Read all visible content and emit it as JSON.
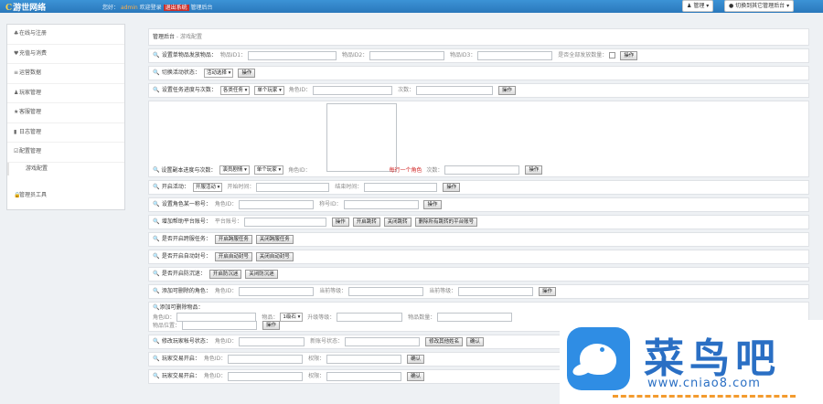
{
  "header": {
    "logo_mark": "C",
    "logo_text": "游世网络",
    "welcome_prefix": "您好：",
    "username": "admin",
    "welcome_mid": "欢迎登录",
    "exit_label": "退出系统",
    "welcome_suffix": "管理后台",
    "manage_button": "管理",
    "switch_button": "切换到其它管理后台"
  },
  "sidebar": {
    "items": [
      {
        "label": "在线与注册",
        "icon": "♣"
      },
      {
        "label": "充值与消费",
        "icon": "♥"
      },
      {
        "label": "运营数据",
        "icon": "≡"
      },
      {
        "label": "玩家管理",
        "icon": "♟"
      },
      {
        "label": "客服管理",
        "icon": "★"
      },
      {
        "label": "日志管理",
        "icon": "▮"
      },
      {
        "label": "配置管理",
        "icon": "☑"
      }
    ],
    "active_sub": "游戏配置",
    "tools": {
      "label": "管理员工具",
      "icon": "🔒"
    }
  },
  "breadcrumb": {
    "root": "管理后台",
    "sep": " - ",
    "current": "游戏配置"
  },
  "forms": {
    "f1": {
      "title": "设置单物品发放物品：",
      "item1": "物品ID1：",
      "item2": "物品ID2：",
      "item3": "物品ID3：",
      "check_label": "是否全部发放数量：",
      "button": "操作"
    },
    "f2": {
      "title": "切换活动状态：",
      "select": "活动选择",
      "button": "操作"
    },
    "f3": {
      "title": "设置任务进度与次数：",
      "select1": "各类任务",
      "select2": "单个玩家",
      "role_label": "角色ID：",
      "times_label": "次数：",
      "button": "操作"
    },
    "f4": {
      "title": "设置副本进度与次数：",
      "select1": "演员剧情",
      "select2": "单个玩家",
      "role_label": "角色ID：",
      "warn": "每行一个角色",
      "times_label": "次数：",
      "button": "操作"
    },
    "f5": {
      "title": "开启活动：",
      "select": "开服活动",
      "start_label": "开始时间：",
      "end_label": "结束时间：",
      "button": "操作"
    },
    "f6": {
      "title": "设置角色某一称号：",
      "role_label": "角色ID：",
      "title_label": "称号ID：",
      "button": "操作"
    },
    "f7": {
      "title": "增加帮助平台账号：",
      "platform_label": "平台账号：",
      "btn_operate": "操作",
      "btn_open": "开启跳转",
      "btn_close": "关闭跳转",
      "btn_all": "删除所有跳转的平台账号"
    },
    "f8": {
      "title": "是否开启跨服任务：",
      "btn_open": "开启跨服任务",
      "btn_close": "关闭跨服任务"
    },
    "f9": {
      "title": "是否开启自动封号：",
      "btn_open": "开启自动封号",
      "btn_close": "关闭自动封号"
    },
    "f10": {
      "title": "是否开启防沉迷：",
      "btn_open": "开启防沉迷",
      "btn_close": "关闭防沉迷"
    },
    "f11": {
      "title": "添加可删除的角色：",
      "role_label": "角色ID：",
      "level_label": "当前等级：",
      "target_label": "当前等级：",
      "button": "操作"
    },
    "f12": {
      "title": "添加可删除物品：",
      "role_label": "角色ID：",
      "item_label": "物品：",
      "item_select": "1级石",
      "upgrade_label": "升级等级：",
      "count_label": "物品数量：",
      "pos_label": "物品位置：",
      "button": "操作"
    },
    "f13": {
      "title": "修改玩家帐号状态：",
      "acct_label": "角色ID：",
      "new_label": "新账号状态：",
      "btn_rename": "修改其他姓名",
      "btn_ok": "确认"
    },
    "f14": {
      "title": "玩家交易开启：",
      "role_label": "角色ID：",
      "value_label": "权限：",
      "button": "确认"
    },
    "f15": {
      "title": "玩家交易开启：",
      "role_label": "角色ID：",
      "value_label": "权限：",
      "button": "确认"
    }
  },
  "watermark": {
    "cn": "菜鸟吧",
    "url": "www.cniao8.com"
  }
}
